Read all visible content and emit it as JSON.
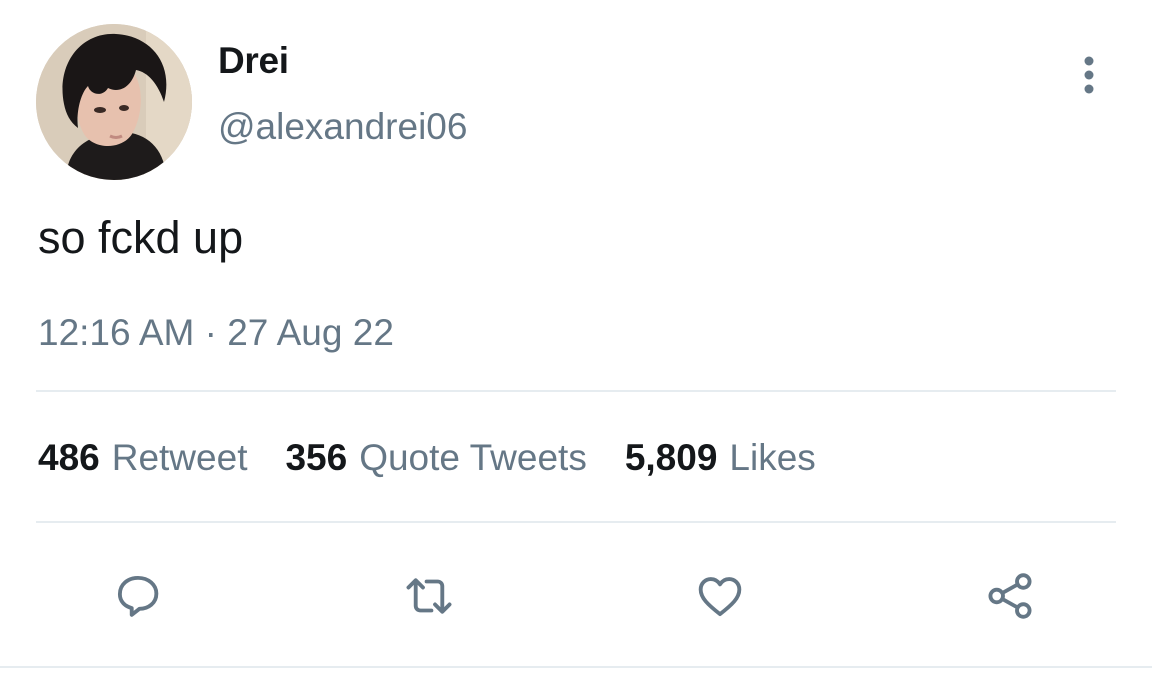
{
  "user": {
    "display_name": "Drei",
    "handle": "@alexandrei06",
    "avatar_icon": "profile-photo"
  },
  "tweet": {
    "text": "so fckd up",
    "time": "12:16 AM",
    "separator": "·",
    "date": "27 Aug 22"
  },
  "stats": {
    "retweets": {
      "count": "486",
      "label": "Retweet"
    },
    "quotes": {
      "count": "356",
      "label": "Quote Tweets"
    },
    "likes": {
      "count": "5,809",
      "label": "Likes"
    }
  },
  "actions": {
    "reply_icon": "comment-icon",
    "retweet_icon": "retweet-icon",
    "like_icon": "heart-icon",
    "share_icon": "share-icon"
  },
  "colors": {
    "primary_text": "#14171a",
    "secondary_text": "#657786",
    "divider": "#e6ecf0",
    "icon": "#657786"
  }
}
